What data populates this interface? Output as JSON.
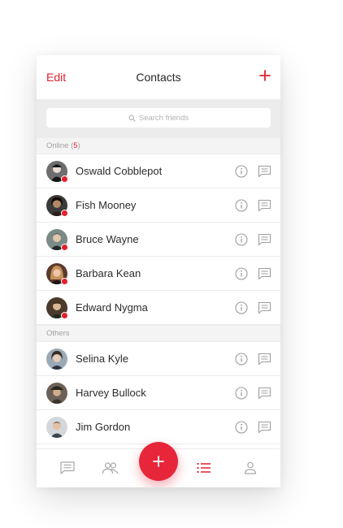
{
  "header": {
    "edit_label": "Edit",
    "title": "Contacts",
    "add_icon": "plus-icon"
  },
  "search": {
    "placeholder": "Search friends",
    "icon": "search-icon"
  },
  "online": {
    "label": "Online (",
    "count": "5",
    "close": ")"
  },
  "others": {
    "label": "Others"
  },
  "contacts": [
    {
      "name": "Oswald Cobblepot",
      "online": true
    },
    {
      "name": "Fish Mooney",
      "online": true
    },
    {
      "name": "Bruce Wayne",
      "online": true
    },
    {
      "name": "Barbara Kean",
      "online": true
    },
    {
      "name": "Edward Nygma",
      "online": true
    },
    {
      "name": "Selina Kyle",
      "online": false
    },
    {
      "name": "Harvey Bullock",
      "online": false
    },
    {
      "name": "Jim Gordon",
      "online": false
    }
  ],
  "tabbar": {
    "tabs": [
      "chat-icon",
      "people-icon",
      "add-fab",
      "list-icon",
      "profile-icon"
    ],
    "active": "list-icon"
  },
  "colors": {
    "accent": "#e0202f",
    "fab": "#e8263a",
    "band": "#ececec",
    "text": "#2b2b2b"
  }
}
